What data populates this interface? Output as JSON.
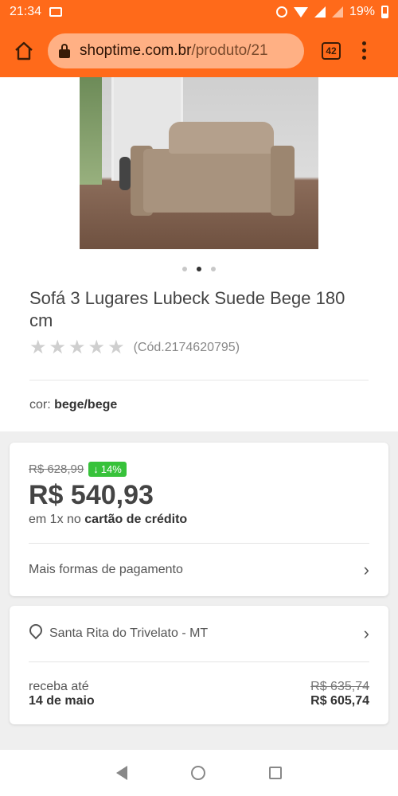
{
  "status_bar": {
    "time": "21:34",
    "battery": "19%"
  },
  "browser": {
    "url_domain": "shoptime.com.br",
    "url_path": "/produto/21",
    "tab_count": "42"
  },
  "product": {
    "title": "Sofá 3 Lugares Lubeck Suede Bege 180 cm",
    "rating_stars": 0,
    "rating_max": 5,
    "code": "(Cód.2174620795)",
    "color_label": "cor:",
    "color_value": "bege/bege",
    "image_count": 3,
    "image_active_index": 1
  },
  "price": {
    "old_price": "R$ 628,99",
    "discount": "14%",
    "current_price": "R$ 540,93",
    "installment_prefix": "em 1x no",
    "installment_bold": "cartão de crédito",
    "more_payment": "Mais formas de pagamento"
  },
  "shipping": {
    "location": "Santa Rita do Trivelato - MT",
    "receive_label": "receba até",
    "receive_date": "14 de maio",
    "old_price": "R$ 635,74",
    "price": "R$ 605,74"
  },
  "colors": {
    "brand_orange": "#ff6a1a",
    "discount_green": "#37c23a"
  }
}
